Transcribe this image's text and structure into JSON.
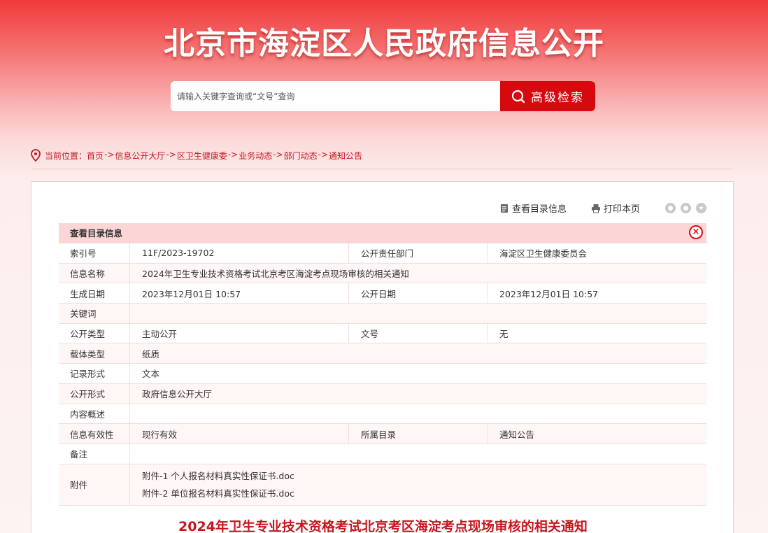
{
  "header": {
    "site_title": "北京市海淀区人民政府信息公开",
    "search_placeholder": "请输入关键字查询或“文号”查询",
    "search_button": "高级检索"
  },
  "breadcrumb": {
    "prefix": "当前位置：",
    "items": [
      "首页",
      "信息公开大厅",
      "区卫生健康委",
      "业务动态",
      "部门动态",
      "通知公告"
    ],
    "separator": "->"
  },
  "tools": {
    "catalog": "查看目录信息",
    "print": "打印本页",
    "share_icons": [
      "wechat-icon",
      "weibo-icon",
      "star-icon"
    ]
  },
  "meta": {
    "heading": "查看目录信息",
    "rows": {
      "index_label": "索引号",
      "index_value": "11F/2023-19702",
      "dept_label": "公开责任部门",
      "dept_value": "海淀区卫生健康委员会",
      "name_label": "信息名称",
      "name_value": "2024年卫生专业技术资格考试北京考区海淀考点现场审核的相关通知",
      "created_label": "生成日期",
      "created_value": "2023年12月01日 10:57",
      "pub_date_label": "公开日期",
      "pub_date_value": "2023年12月01日 10:57",
      "keywords_label": "关键词",
      "keywords_value": "",
      "type_label": "公开类型",
      "type_value": "主动公开",
      "doc_no_label": "文号",
      "doc_no_value": "无",
      "carrier_label": "载体类型",
      "carrier_value": "纸质",
      "record_label": "记录形式",
      "record_value": "文本",
      "form_label": "公开形式",
      "form_value": "政府信息公开大厅",
      "summary_label": "内容概述",
      "summary_value": "",
      "validity_label": "信息有效性",
      "validity_value": "现行有效",
      "catalog_label": "所属目录",
      "catalog_value": "通知公告",
      "remark_label": "备注",
      "remark_value": "",
      "attach_label": "附件",
      "attachments": [
        "附件-1 个人报名材料真实性保证书.doc",
        "附件-2 单位报名材料真实性保证书.doc"
      ]
    }
  },
  "article": {
    "title": "2024年卫生专业技术资格考试北京考区海淀考点现场审核的相关通知"
  },
  "colors": {
    "brand_red": "#d6090f",
    "link_red": "#c8161e",
    "header_pink": "#fcd6d6"
  }
}
